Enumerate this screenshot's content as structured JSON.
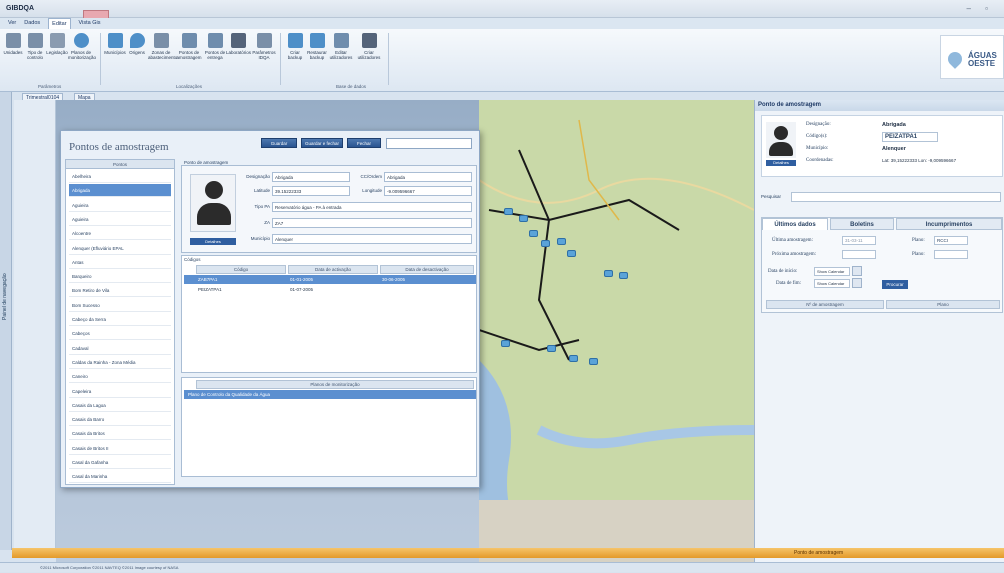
{
  "window": {
    "title": "GIBDQA"
  },
  "menu": {
    "items": [
      "Ver",
      "Dados",
      "Editar",
      "Vista Gis"
    ],
    "active": "Editar"
  },
  "ribbon": {
    "groups": [
      {
        "label": "Parâmetros",
        "buttons": [
          "Unidades",
          "Tipo de controlo",
          "Legislação",
          "Planos de monitorização"
        ]
      },
      {
        "label": "Localizações",
        "buttons": [
          "Municípios",
          "Origens",
          "Zonas de abastecimento",
          "Pontos de amostragem",
          "Pontos de entrega",
          "Laboratórios",
          "Parâmetros IDQA"
        ]
      },
      {
        "label": "Base de dados",
        "buttons": [
          "Criar backup",
          "Restaurar backup",
          "Editar utilizadores",
          "Criar utilizadores"
        ]
      }
    ]
  },
  "brand": {
    "line1": "ÁGUAS",
    "line2": "OESTE"
  },
  "doctabs": [
    "Trimestral0104",
    "Mapa"
  ],
  "nav": {
    "label": "Painel de navegação"
  },
  "panel": {
    "title": "Pontos de amostragem",
    "buttons": [
      "Guardar",
      "Guardar e fechar",
      "Fechar"
    ],
    "list_header": "Pontos",
    "list": [
      "Abelheira",
      "Abrigada",
      "Aguieira",
      "Aguieira",
      "Alcoentre",
      "Alenquer (Efluviário EPAL",
      "Antas",
      "Barqueiro",
      "Bom Retiro de Vila",
      "Bom Sucesso",
      "Cabeço da Serra",
      "Cabeços",
      "Cadaval",
      "Caldas da Rainha - Zona Média",
      "Caneiro",
      "Capeleira",
      "Casais da Lagoa",
      "Casais da Barro",
      "Casais da Britos",
      "Casais de Britos II",
      "Casal da Gafanha",
      "Casal da Marinha"
    ],
    "selected_index": 1,
    "detail_label": "Ponto de amostragem",
    "fields": {
      "designacao_label": "Designação",
      "designacao": "Abrigada",
      "ccordem_label": "CC/Ordem",
      "ccordem": "Abrigada",
      "latitude_label": "Latitude",
      "latitude": "39.15222333",
      "longitude_label": "Longitude",
      "longitude": "-9.009596667",
      "tipo_label": "Tipo PA",
      "tipo": "Reservatório água - PA à entrada",
      "za_label": "ZA",
      "za": "ZA7",
      "municipio_label": "Município",
      "municipio": "Alenquer"
    },
    "photo_button": "Detalhes",
    "codigo": {
      "label": "Códigos",
      "headers": [
        "Código",
        "Data de activação",
        "Data de desactivação"
      ],
      "rows": [
        {
          "codigo": "ZAB7PA1",
          "ativ": "01-01-2005",
          "desat": "30-06-2005"
        },
        {
          "codigo": "PEIZATPA1",
          "ativ": "01-07-2005",
          "desat": ""
        }
      ]
    },
    "planos": {
      "header": "Planos de monitorização",
      "rows": [
        "Plano de Controlo da Qualidade da Água"
      ]
    }
  },
  "right": {
    "header": "Ponto de amostragem",
    "designacao_label": "Designação:",
    "designacao": "Abrigada",
    "codigo_label": "Código(s):",
    "codigo": "PEIZATPA1",
    "municipio_label": "Município:",
    "municipio": "Alenquer",
    "coord_label": "Coordenadas:",
    "coord": "Lat: 39,15222333  Lon: -9,009596667",
    "search_label": "Pesquisar",
    "tabs": [
      "Últimos dados",
      "Boletins",
      "Incumprimentos"
    ],
    "ultima_label": "Última amostragem:",
    "ultima": "31-03-11",
    "plano_label": "Plano:",
    "plano": "RCCI",
    "proxima_label": "Próxima amostragem:",
    "plano2_label": "Plano:",
    "inicio_label": "Data de início:",
    "inicio": "Show Calendar",
    "fim_label": "Data de fim:",
    "fim": "Show Calendar",
    "procurar": "Procurar",
    "cols": [
      "Nº de amostragem",
      "Plano"
    ],
    "footer": "Ponto de amostragem"
  },
  "status": {
    "text": "©2011 Microsoft Corporation ©2011 NAVTEQ ©2011 Image courtesy of NASA"
  },
  "colors": {
    "accent": "#2f5ea0",
    "selected": "#5b8fd0",
    "footer": "#e39a2a"
  }
}
